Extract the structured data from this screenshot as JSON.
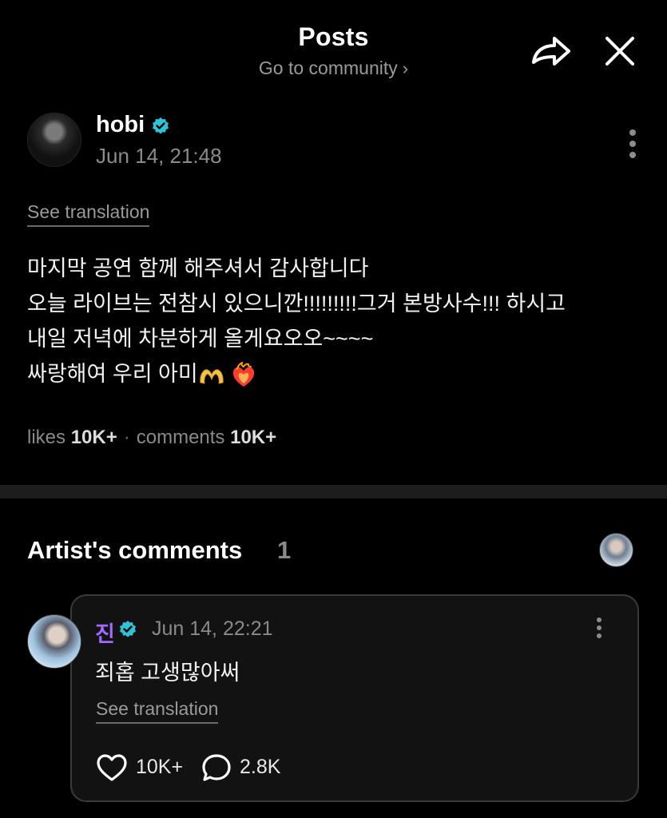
{
  "header": {
    "title": "Posts",
    "subtitle": "Go to community",
    "subtitle_chevron": "›",
    "share_icon": "share-arrow-icon",
    "close_icon": "close-icon"
  },
  "post": {
    "author": "hobi",
    "verified_color": "#2ec4d6",
    "timestamp": "Jun 14, 21:48",
    "see_translation": "See translation",
    "body_lines": [
      "마지막 공연 함께 해주셔서 감사합니다",
      "오늘 라이브는 전참시 있으니깐!!!!!!!!!그거 본방사수!!! 하시고",
      "내일 저녁에 차분하게 올게요오오~~~~",
      "싸랑해여 우리 아미"
    ],
    "emojis": [
      "heart-hands-emoji",
      "heart-on-fire-emoji"
    ],
    "stats": {
      "likes_label": "likes",
      "likes_value": "10K+",
      "separator": "·",
      "comments_label": "comments",
      "comments_value": "10K+"
    }
  },
  "artist_comments": {
    "title": "Artist's comments",
    "count": "1",
    "comment": {
      "author": "진",
      "author_color": "#9f6bff",
      "timestamp": "Jun 14, 22:21",
      "text": "죄홉 고생많아써",
      "see_translation": "See translation",
      "likes": "10K+",
      "replies": "2.8K"
    }
  },
  "colors": {
    "background": "#000000",
    "muted_text": "#8a8a8a",
    "divider": "#1d1d1d",
    "card_border": "#3a3a3a"
  }
}
